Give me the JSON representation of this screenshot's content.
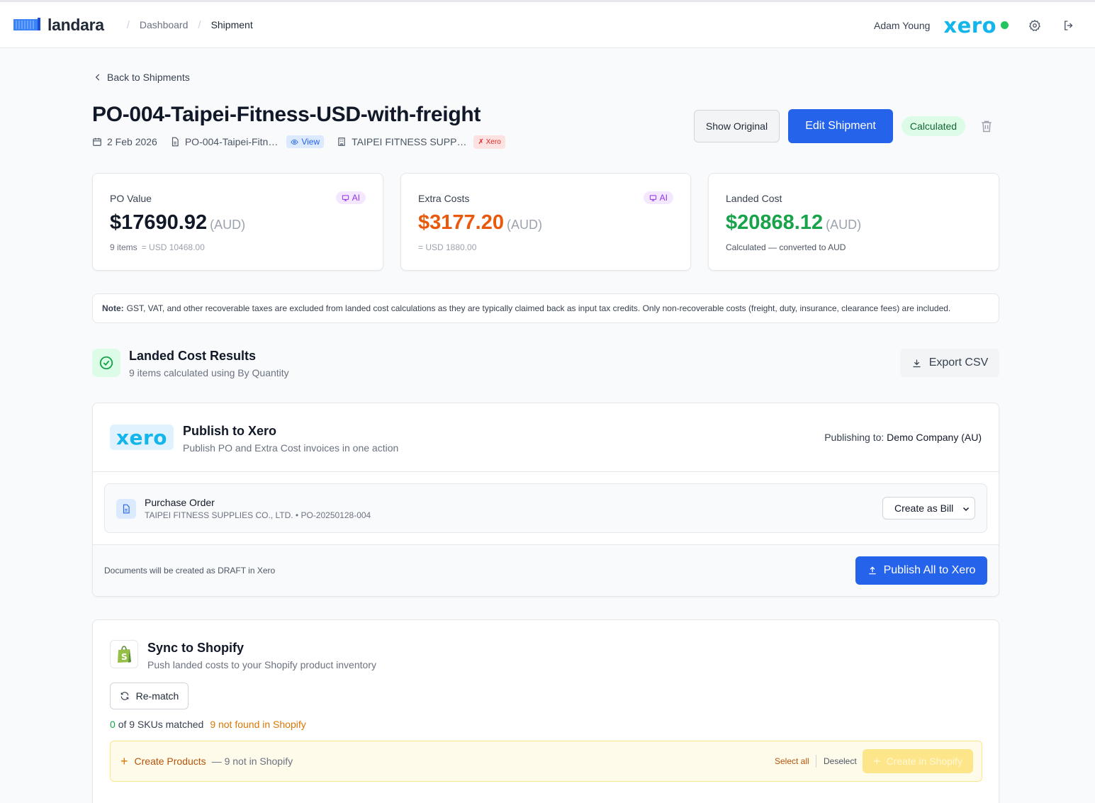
{
  "header": {
    "brand": "landara",
    "breadcrumbs": [
      "Dashboard",
      "Shipment"
    ],
    "user_name": "Adam Young",
    "xero_brand": "xero",
    "xero_connected_color": "#22c55e",
    "icons": [
      "settings-icon",
      "logout-icon"
    ]
  },
  "shipment": {
    "back_label": "Back to Shipments",
    "title": "PO-004-Taipei-Fitness-USD-with-freight",
    "date": "2 Feb 2026",
    "file_name": "PO-004-Taipei-Fitn…",
    "view_label": "View",
    "supplier": "TAIPEI FITNESS SUPP…",
    "xero_badge": "✗ Xero",
    "show_original_label": "Show Original",
    "edit_label": "Edit Shipment",
    "status": "Calculated"
  },
  "stats": [
    {
      "label": "PO Value",
      "ai": "AI",
      "amount": "$17690.92",
      "currency": "(AUD)",
      "sub": "9 items",
      "conv": "= USD 10468.00",
      "color": "#111827"
    },
    {
      "label": "Extra Costs",
      "ai": "AI",
      "amount": "$3177.20",
      "currency": "(AUD)",
      "sub": "= USD 1880.00",
      "color": "#ea580c"
    },
    {
      "label": "Landed Cost",
      "amount": "$20868.12",
      "currency": "(AUD)",
      "sub": "Calculated — converted to AUD",
      "color": "#16a34a"
    }
  ],
  "note": {
    "label": "Note:",
    "text": "GST, VAT, and other recoverable taxes are excluded from landed cost calculations as they are typically claimed back as input tax credits. Only non-recoverable costs (freight, duty, insurance, clearance fees) are included."
  },
  "results": {
    "title": "Landed Cost Results",
    "subtitle": "9 items calculated using By Quantity",
    "export_label": "Export CSV"
  },
  "xero_publish": {
    "logo": "xero",
    "title": "Publish to Xero",
    "subtitle": "Publish PO and Extra Cost invoices in one action",
    "publishing_to_label": "Publishing to:",
    "company": "Demo Company (AU)",
    "po_title": "Purchase Order",
    "po_sub": "TAIPEI FITNESS SUPPLIES CO., LTD. • PO-20250128-004",
    "create_as": "Create as Bill",
    "draft_note": "Documents will be created as DRAFT in Xero",
    "publish_label": "Publish All to Xero"
  },
  "shopify": {
    "title": "Sync to Shopify",
    "subtitle": "Push landed costs to your Shopify product inventory",
    "rematch_label": "Re-match",
    "matched_count": "0",
    "matched_text": "of 9 SKUs matched",
    "not_found": "9 not found in Shopify",
    "create_products_label": "Create Products",
    "not_in_shopify": "— 9 not in Shopify",
    "select_all": "Select all",
    "deselect": "Deselect",
    "create_in_shopify": "Create in Shopify"
  }
}
